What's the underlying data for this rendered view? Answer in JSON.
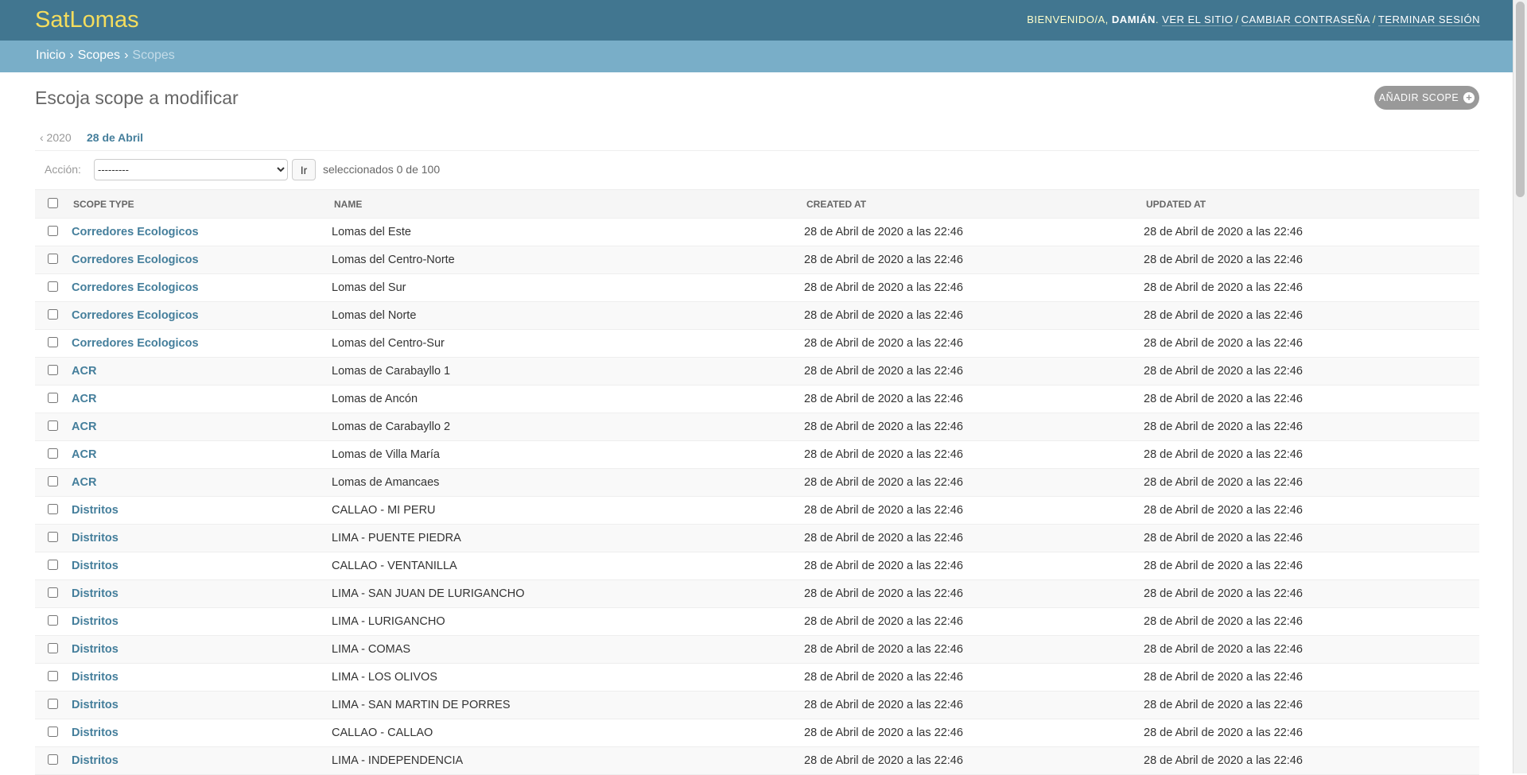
{
  "header": {
    "brand": "SatLomas",
    "welcome": "BIENVENIDO/A,",
    "user": "DAMIÁN",
    "view_site": "VER EL SITIO",
    "change_password": "CAMBIAR CONTRASEÑA",
    "logout": "TERMINAR SESIÓN"
  },
  "breadcrumbs": {
    "home": "Inicio",
    "app": "Scopes",
    "current": "Scopes"
  },
  "page": {
    "title": "Escoja scope a modificar",
    "add_button": "AÑADIR SCOPE"
  },
  "date_hierarchy": {
    "back": "‹ 2020",
    "current": "28 de Abril"
  },
  "actions": {
    "label": "Acción:",
    "selected_option": "---------",
    "go": "Ir",
    "counter": "seleccionados 0 de 100"
  },
  "table": {
    "headers": [
      "SCOPE TYPE",
      "NAME",
      "CREATED AT",
      "UPDATED AT"
    ],
    "rows": [
      {
        "type": "Corredores Ecologicos",
        "name": "Lomas del Este",
        "created": "28 de Abril de 2020 a las 22:46",
        "updated": "28 de Abril de 2020 a las 22:46"
      },
      {
        "type": "Corredores Ecologicos",
        "name": "Lomas del Centro-Norte",
        "created": "28 de Abril de 2020 a las 22:46",
        "updated": "28 de Abril de 2020 a las 22:46"
      },
      {
        "type": "Corredores Ecologicos",
        "name": "Lomas del Sur",
        "created": "28 de Abril de 2020 a las 22:46",
        "updated": "28 de Abril de 2020 a las 22:46"
      },
      {
        "type": "Corredores Ecologicos",
        "name": "Lomas del Norte",
        "created": "28 de Abril de 2020 a las 22:46",
        "updated": "28 de Abril de 2020 a las 22:46"
      },
      {
        "type": "Corredores Ecologicos",
        "name": "Lomas del Centro-Sur",
        "created": "28 de Abril de 2020 a las 22:46",
        "updated": "28 de Abril de 2020 a las 22:46"
      },
      {
        "type": "ACR",
        "name": "Lomas de Carabayllo 1",
        "created": "28 de Abril de 2020 a las 22:46",
        "updated": "28 de Abril de 2020 a las 22:46"
      },
      {
        "type": "ACR",
        "name": "Lomas de Ancón",
        "created": "28 de Abril de 2020 a las 22:46",
        "updated": "28 de Abril de 2020 a las 22:46"
      },
      {
        "type": "ACR",
        "name": "Lomas de Carabayllo 2",
        "created": "28 de Abril de 2020 a las 22:46",
        "updated": "28 de Abril de 2020 a las 22:46"
      },
      {
        "type": "ACR",
        "name": "Lomas de Villa María",
        "created": "28 de Abril de 2020 a las 22:46",
        "updated": "28 de Abril de 2020 a las 22:46"
      },
      {
        "type": "ACR",
        "name": "Lomas de Amancaes",
        "created": "28 de Abril de 2020 a las 22:46",
        "updated": "28 de Abril de 2020 a las 22:46"
      },
      {
        "type": "Distritos",
        "name": "CALLAO - MI PERU",
        "created": "28 de Abril de 2020 a las 22:46",
        "updated": "28 de Abril de 2020 a las 22:46"
      },
      {
        "type": "Distritos",
        "name": "LIMA - PUENTE PIEDRA",
        "created": "28 de Abril de 2020 a las 22:46",
        "updated": "28 de Abril de 2020 a las 22:46"
      },
      {
        "type": "Distritos",
        "name": "CALLAO - VENTANILLA",
        "created": "28 de Abril de 2020 a las 22:46",
        "updated": "28 de Abril de 2020 a las 22:46"
      },
      {
        "type": "Distritos",
        "name": "LIMA - SAN JUAN DE LURIGANCHO",
        "created": "28 de Abril de 2020 a las 22:46",
        "updated": "28 de Abril de 2020 a las 22:46"
      },
      {
        "type": "Distritos",
        "name": "LIMA - LURIGANCHO",
        "created": "28 de Abril de 2020 a las 22:46",
        "updated": "28 de Abril de 2020 a las 22:46"
      },
      {
        "type": "Distritos",
        "name": "LIMA - COMAS",
        "created": "28 de Abril de 2020 a las 22:46",
        "updated": "28 de Abril de 2020 a las 22:46"
      },
      {
        "type": "Distritos",
        "name": "LIMA - LOS OLIVOS",
        "created": "28 de Abril de 2020 a las 22:46",
        "updated": "28 de Abril de 2020 a las 22:46"
      },
      {
        "type": "Distritos",
        "name": "LIMA - SAN MARTIN DE PORRES",
        "created": "28 de Abril de 2020 a las 22:46",
        "updated": "28 de Abril de 2020 a las 22:46"
      },
      {
        "type": "Distritos",
        "name": "CALLAO - CALLAO",
        "created": "28 de Abril de 2020 a las 22:46",
        "updated": "28 de Abril de 2020 a las 22:46"
      },
      {
        "type": "Distritos",
        "name": "LIMA - INDEPENDENCIA",
        "created": "28 de Abril de 2020 a las 22:46",
        "updated": "28 de Abril de 2020 a las 22:46"
      }
    ]
  }
}
